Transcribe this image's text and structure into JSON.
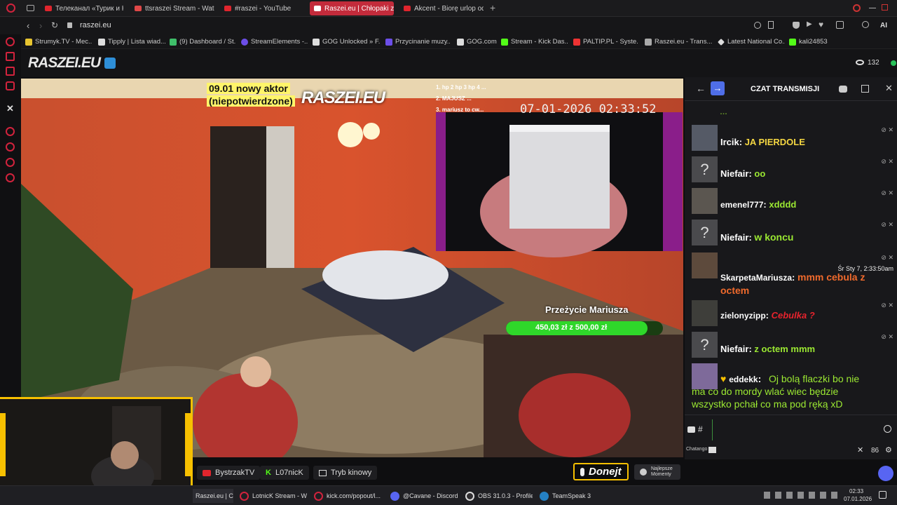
{
  "browser": {
    "tabs": [
      {
        "label": "Телеканал «Турик и Кон..."
      },
      {
        "label": "ttsraszei Stream - Watch L"
      },
      {
        "label": "#raszei - YouTube"
      },
      {
        "label": "Raszei.eu | Chłopaki z"
      },
      {
        "label": "Akcent - Biorę urlop od Ci"
      }
    ],
    "address": "raszei.eu",
    "bookmarks": [
      {
        "label": "Strumyk.TV - Mec..."
      },
      {
        "label": "Tipply | Lista wiad..."
      },
      {
        "label": "(9) Dashboard / St..."
      },
      {
        "label": "StreamElements -..."
      },
      {
        "label": "GOG Unlocked » F..."
      },
      {
        "label": "Przycinanie muzy..."
      },
      {
        "label": "GOG.com"
      },
      {
        "label": "Stream - Kick Das..."
      },
      {
        "label": "PALTIP.PL - Syste..."
      },
      {
        "label": "Raszei.eu - Trans..."
      },
      {
        "label": "Latest National Co..."
      },
      {
        "label": "kali24853"
      }
    ],
    "ext_label": "AI"
  },
  "site": {
    "logo": "RASZEI.EU",
    "viewers": "132"
  },
  "video": {
    "overlay_title_1": "09.01 nowy aktor",
    "overlay_title_2": "(niepotwierdzone)",
    "overlay_logo": "RASZEI.EU",
    "timestamp": "07-01-2026 02:33:52",
    "goal_label": "Przeżycie Mariusza",
    "goal_value": "450,03 zł z 500,00 zł",
    "goal_percent": 0.9,
    "leaderboard": [
      "1. hp 2 hp 3 hp 4 ...",
      "2. MAJUSZ ...",
      "3. mariusz to cw..."
    ]
  },
  "chat": {
    "header": "CZAT TRANSMISJI",
    "messages": [
      {
        "user": "Ircik",
        "text": "JA PIERDOLE",
        "color": "#f5d742",
        "avatar": "photo"
      },
      {
        "user": "Niefair",
        "text": "oo",
        "color": "#9be832",
        "avatar": "?"
      },
      {
        "user": "emenel777",
        "text": "xdddd",
        "color": "#9be832",
        "avatar": "photo"
      },
      {
        "user": "Niefair",
        "text": "w koncu",
        "color": "#9be832",
        "avatar": "?"
      },
      {
        "user": "SkarpetaMariusza",
        "text": "mmm cebula z octem",
        "color": "#f06a2c",
        "avatar": "photo",
        "time": "Śr Sty 7, 2:33:50am"
      },
      {
        "user": "zielonyzipp",
        "text": "Cebulka ?",
        "color": "#e8232d",
        "avatar": "photo"
      },
      {
        "user": "Niefair",
        "text": "z octem mmm",
        "color": "#9be832",
        "avatar": "?"
      },
      {
        "user": "eddekk",
        "text": "Oj bolą flaczki bo nie ma co do mordy wlać wiec będzie wszystko pchał co ma pod ręką xD",
        "color": "#9be832",
        "avatar": "photo"
      }
    ],
    "input_prefix": "#",
    "footer_brand": "Chatango",
    "volume": "86"
  },
  "controls": {
    "btn1": "BystrzakTV",
    "btn2": "L07nicK",
    "btn3": "Tryb kinowy",
    "donate": "Donejt",
    "best": "Najlepsze Momenty"
  },
  "taskbar": {
    "items": [
      {
        "label": "Raszei.eu | Chłopak..."
      },
      {
        "label": "LotnicK Stream - W..."
      },
      {
        "label": "kick.com/popout/l..."
      },
      {
        "label": "@Cavane - Discord"
      },
      {
        "label": "OBS 31.0.3 - Profile..."
      },
      {
        "label": "TeamSpeak 3"
      }
    ],
    "time": "02:33",
    "date": "07.01.2026"
  }
}
